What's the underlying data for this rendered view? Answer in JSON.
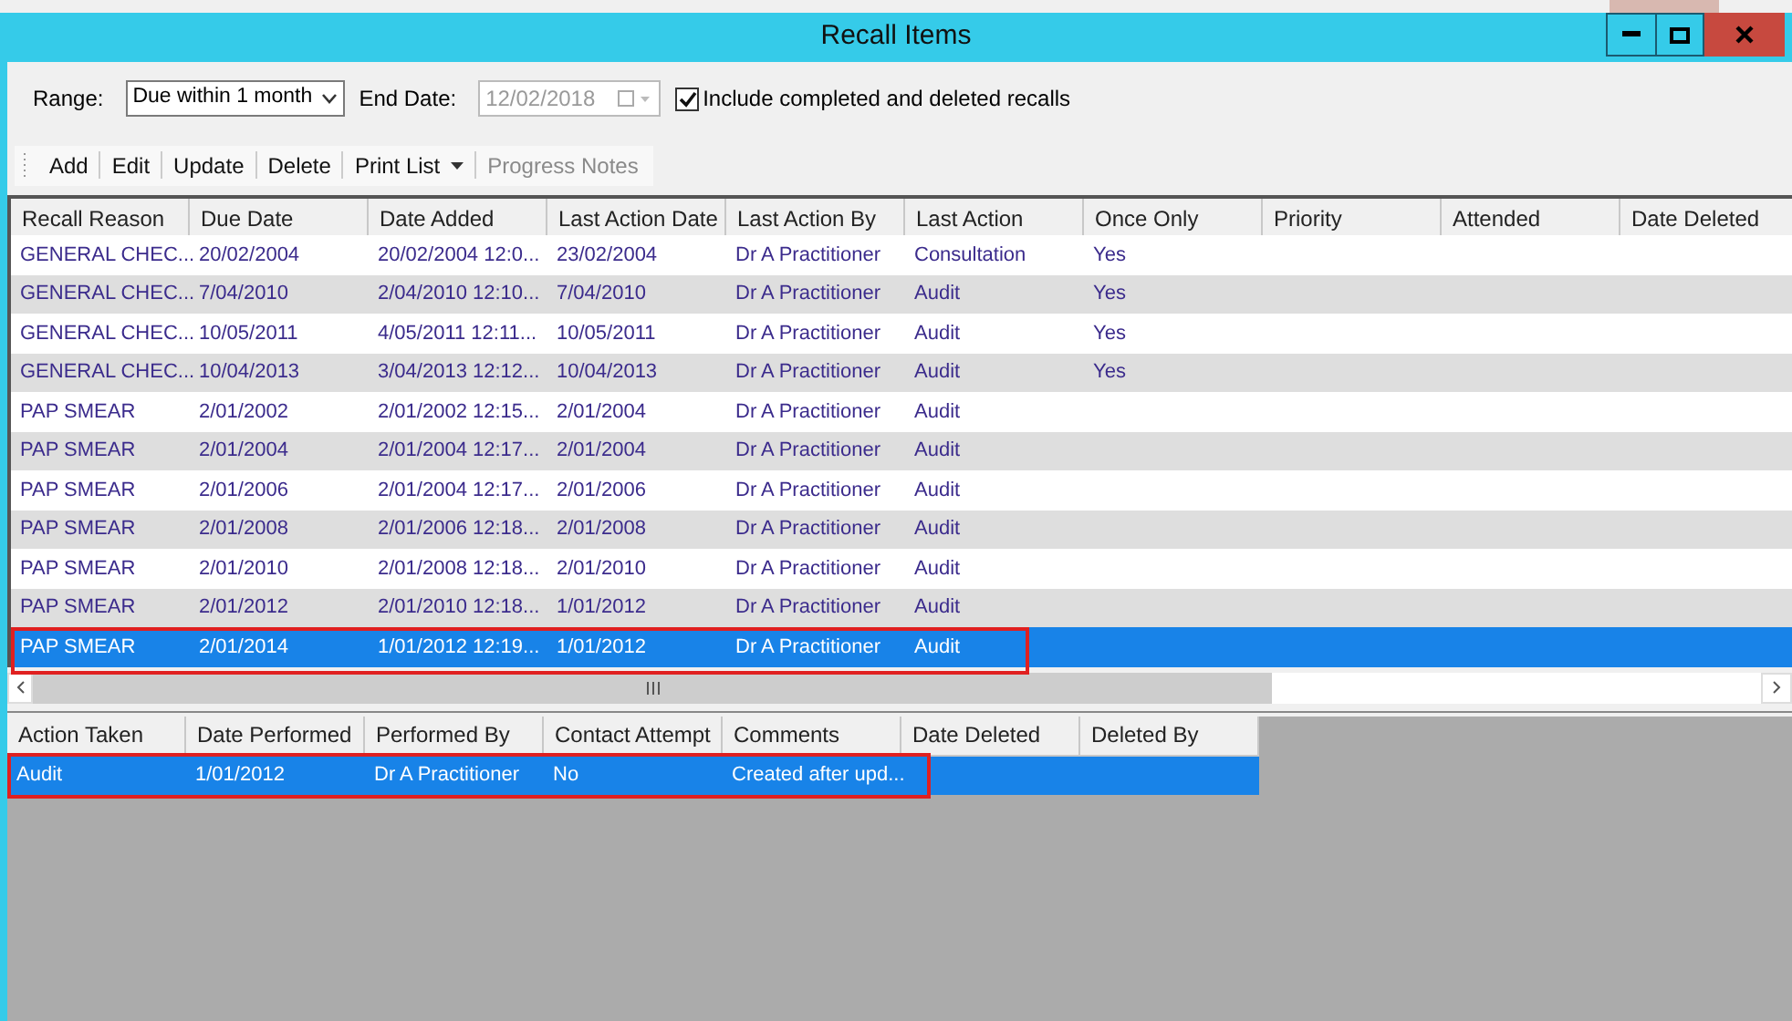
{
  "window": {
    "title": "Recall Items"
  },
  "filters": {
    "range_label": "Range:",
    "range_value": "Due within 1 month",
    "end_date_label": "End Date:",
    "end_date_value": "12/02/2018",
    "end_date_disabled": true,
    "include_label": "Include completed and deleted recalls",
    "include_checked": true
  },
  "toolbar": [
    {
      "label": "Add",
      "kind": "button",
      "disabled": false
    },
    {
      "label": "Edit",
      "kind": "button",
      "disabled": false
    },
    {
      "label": "Update",
      "kind": "button",
      "disabled": false
    },
    {
      "label": "Delete",
      "kind": "button",
      "disabled": false
    },
    {
      "label": "Print List",
      "kind": "dropdown",
      "disabled": false
    },
    {
      "label": "Progress Notes",
      "kind": "button",
      "disabled": true
    }
  ],
  "recalls": {
    "columns": [
      "Recall Reason",
      "Due Date",
      "Date Added",
      "Last Action Date",
      "Last Action By",
      "Last Action",
      "Once Only",
      "Priority",
      "Attended",
      "Date Deleted"
    ],
    "rows": [
      {
        "cells": [
          "GENERAL CHEC...",
          "20/02/2004",
          "20/02/2004 12:0...",
          "23/02/2004",
          "Dr A Practitioner",
          "Consultation",
          "Yes",
          "",
          "",
          ""
        ],
        "selected": false,
        "annotated": false
      },
      {
        "cells": [
          "GENERAL CHEC...",
          "7/04/2010",
          "2/04/2010 12:10...",
          "7/04/2010",
          "Dr A Practitioner",
          "Audit",
          "Yes",
          "",
          "",
          ""
        ],
        "selected": false,
        "annotated": false
      },
      {
        "cells": [
          "GENERAL CHEC...",
          "10/05/2011",
          "4/05/2011 12:11...",
          "10/05/2011",
          "Dr A Practitioner",
          "Audit",
          "Yes",
          "",
          "",
          ""
        ],
        "selected": false,
        "annotated": false
      },
      {
        "cells": [
          "GENERAL CHEC...",
          "10/04/2013",
          "3/04/2013 12:12...",
          "10/04/2013",
          "Dr A Practitioner",
          "Audit",
          "Yes",
          "",
          "",
          ""
        ],
        "selected": false,
        "annotated": false
      },
      {
        "cells": [
          "PAP SMEAR",
          "2/01/2002",
          "2/01/2002 12:15...",
          "2/01/2004",
          "Dr A Practitioner",
          "Audit",
          "",
          "",
          "",
          ""
        ],
        "selected": false,
        "annotated": false
      },
      {
        "cells": [
          "PAP SMEAR",
          "2/01/2004",
          "2/01/2004 12:17...",
          "2/01/2004",
          "Dr A Practitioner",
          "Audit",
          "",
          "",
          "",
          ""
        ],
        "selected": false,
        "annotated": false
      },
      {
        "cells": [
          "PAP SMEAR",
          "2/01/2006",
          "2/01/2004 12:17...",
          "2/01/2006",
          "Dr A Practitioner",
          "Audit",
          "",
          "",
          "",
          ""
        ],
        "selected": false,
        "annotated": false
      },
      {
        "cells": [
          "PAP SMEAR",
          "2/01/2008",
          "2/01/2006 12:18...",
          "2/01/2008",
          "Dr A Practitioner",
          "Audit",
          "",
          "",
          "",
          ""
        ],
        "selected": false,
        "annotated": false
      },
      {
        "cells": [
          "PAP SMEAR",
          "2/01/2010",
          "2/01/2008 12:18...",
          "2/01/2010",
          "Dr A Practitioner",
          "Audit",
          "",
          "",
          "",
          ""
        ],
        "selected": false,
        "annotated": false
      },
      {
        "cells": [
          "PAP SMEAR",
          "2/01/2012",
          "2/01/2010 12:18...",
          "1/01/2012",
          "Dr A Practitioner",
          "Audit",
          "",
          "",
          "",
          ""
        ],
        "selected": false,
        "annotated": false
      },
      {
        "cells": [
          "PAP SMEAR",
          "2/01/2014",
          "1/01/2012 12:19...",
          "1/01/2012",
          "Dr A Practitioner",
          "Audit",
          "",
          "",
          "",
          ""
        ],
        "selected": true,
        "annotated": true
      }
    ]
  },
  "actions": {
    "columns": [
      "Action Taken",
      "Date Performed",
      "Performed By",
      "Contact Attempt",
      "Comments",
      "Date Deleted",
      "Deleted By"
    ],
    "rows": [
      {
        "cells": [
          "Audit",
          "1/01/2012",
          "Dr A Practitioner",
          "No",
          "Created after upd...",
          "",
          ""
        ],
        "selected": true,
        "annotated": true
      }
    ]
  }
}
